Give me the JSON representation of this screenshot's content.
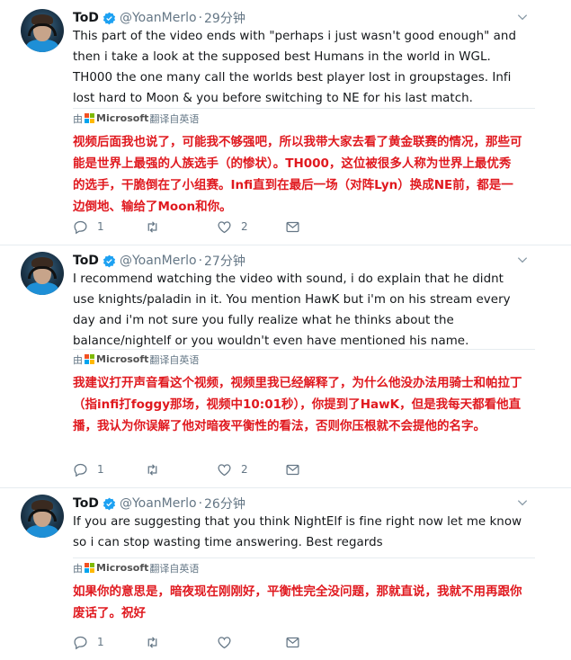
{
  "tweets": [
    {
      "author": "ToD",
      "handle": "@YoanMerlo",
      "time": "29分钟",
      "text": "This part of the video ends with \"perhaps i just wasn't good enough\" and then i take a look at the supposed best Humans in the world in WGL. TH000 the one many call the worlds best player lost in groupstages. Infi lost hard to Moon & you before switching to NE for his last match.",
      "translate_by": "由",
      "translate_brand": "Microsoft",
      "translate_suffix": "翻译自英语",
      "translation": "视频后面我也说了，可能我不够强吧，所以我带大家去看了黄金联赛的情况，那些可能是世界上最强的人族选手（的惨状）。TH000，这位被很多人称为世界上最优秀的选手，干脆倒在了小组赛。Infi直到在最后一场（对阵Lyn）换成NE前，都是一边倒地、输给了Moon和你。",
      "reply_count": "1",
      "retweet_count": "",
      "like_count": "2"
    },
    {
      "author": "ToD",
      "handle": "@YoanMerlo",
      "time": "27分钟",
      "text": "I recommend watching the video with sound, i do explain that he didnt use knights/paladin in it. You mention HawK but i'm on his stream every day and i'm not sure you fully realize what he thinks about the balance/nightelf or you wouldn't even have mentioned his name.",
      "translate_by": "由",
      "translate_brand": "Microsoft",
      "translate_suffix": "翻译自英语",
      "translation": "我建议打开声音看这个视频，视频里我已经解释了，为什么他没办法用骑士和帕拉丁（指infi打foggy那场，视频中10:01秒），你提到了HawK，但是我每天都看他直播，我认为你误解了他对暗夜平衡性的看法，否则你压根就不会提他的名字。",
      "reply_count": "1",
      "retweet_count": "",
      "like_count": "2"
    },
    {
      "author": "ToD",
      "handle": "@YoanMerlo",
      "time": "26分钟",
      "text": "If you are suggesting that you think NightElf is fine right now let me know so i can stop wasting time answering.  Best regards",
      "translate_by": "由",
      "translate_brand": "Microsoft",
      "translate_suffix": "翻译自英语",
      "translation": "如果你的意思是，暗夜现在刚刚好，平衡性完全没问题，那就直说，我就不用再跟你废话了。祝好",
      "reply_count": "1",
      "retweet_count": "",
      "like_count": ""
    }
  ],
  "icons": {
    "verified": "verified-badge-icon",
    "menu": "chevron-down-icon",
    "reply": "reply-icon",
    "retweet": "retweet-icon",
    "like": "heart-icon",
    "dm": "envelope-icon",
    "translator": "microsoft-logo-icon"
  },
  "colors": {
    "accent": "#1da1f2",
    "translation_text": "#e0191f",
    "muted": "#657786"
  }
}
